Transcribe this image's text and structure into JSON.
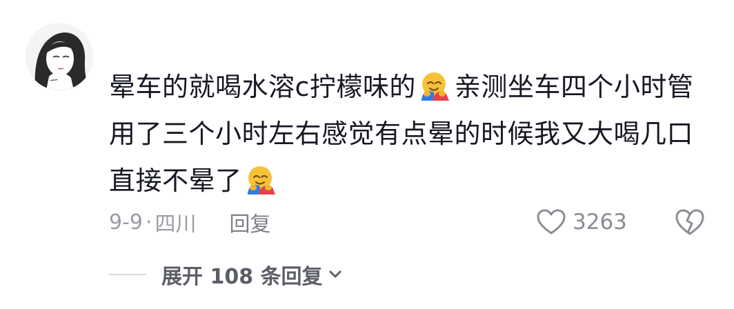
{
  "comment": {
    "avatar_icon": "user-avatar-anime-girl",
    "text_part1": "晕车的就喝水溶c拧檬味的",
    "text_part2": "亲测坐车四个小时管用了三个小时左右感觉有点晕的时候我又大喝几口直接不晕了",
    "emoji_icon": "hugging-face-emoji",
    "date": "9-9",
    "separator": "·",
    "location": "四川",
    "reply_label": "回复",
    "like_count": "3263",
    "like_icon": "heart-outline-icon",
    "dislike_icon": "broken-heart-icon",
    "expand_label": "展开 108 条回复",
    "expand_icon": "chevron-down-icon",
    "colors": {
      "text": "#161823",
      "meta": "#9a9ca3",
      "expand": "#5b5e66"
    }
  }
}
